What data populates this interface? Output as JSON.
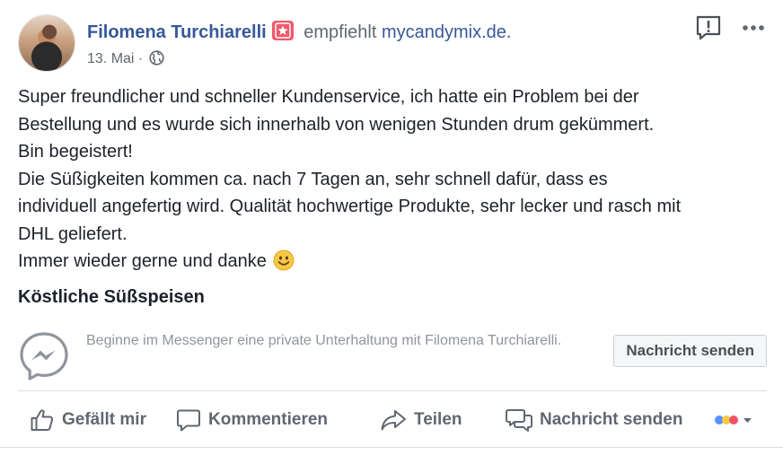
{
  "post": {
    "author": "Filomena Turchiarelli",
    "recommends_text": "empfiehlt",
    "page_name": "mycandymix.de.",
    "date": "13. Mai",
    "date_separator": "·",
    "body_lines": [
      "Super freundlicher und schneller Kundenservice, ich hatte ein Problem bei der",
      "Bestellung und es wurde sich innerhalb von wenigen Stunden drum gekümmert.",
      "Bin begeistert!",
      "Die Süßigkeiten kommen ca. nach 7 Tagen an, sehr schnell dafür, dass es",
      "individuell angefertig wird. Qualität hochwertige Produkte, sehr lecker und rasch mit",
      "DHL geliefert.",
      "Immer wieder gerne und danke"
    ],
    "section_title": "Köstliche Süßspeisen"
  },
  "messenger": {
    "prompt": "Beginne im Messenger eine private Unterhaltung mit Filomena Turchiarelli.",
    "button_label": "Nachricht senden"
  },
  "actions": {
    "like": "Gefällt mir",
    "comment": "Kommentieren",
    "share": "Teilen",
    "message": "Nachricht senden"
  },
  "icons": {
    "badge": "recommendation-star-icon",
    "audience": "globe-icon",
    "report": "report-icon",
    "more": "more-icon",
    "emoji": "smiley-icon",
    "messenger": "messenger-icon",
    "like": "thumbs-up-icon",
    "comment": "comment-icon",
    "share": "share-icon",
    "message": "message-icon",
    "reactions": "reaction-selector-icon"
  },
  "colors": {
    "link": "#365899",
    "muted": "#606770",
    "badge": "#f15a6c"
  }
}
